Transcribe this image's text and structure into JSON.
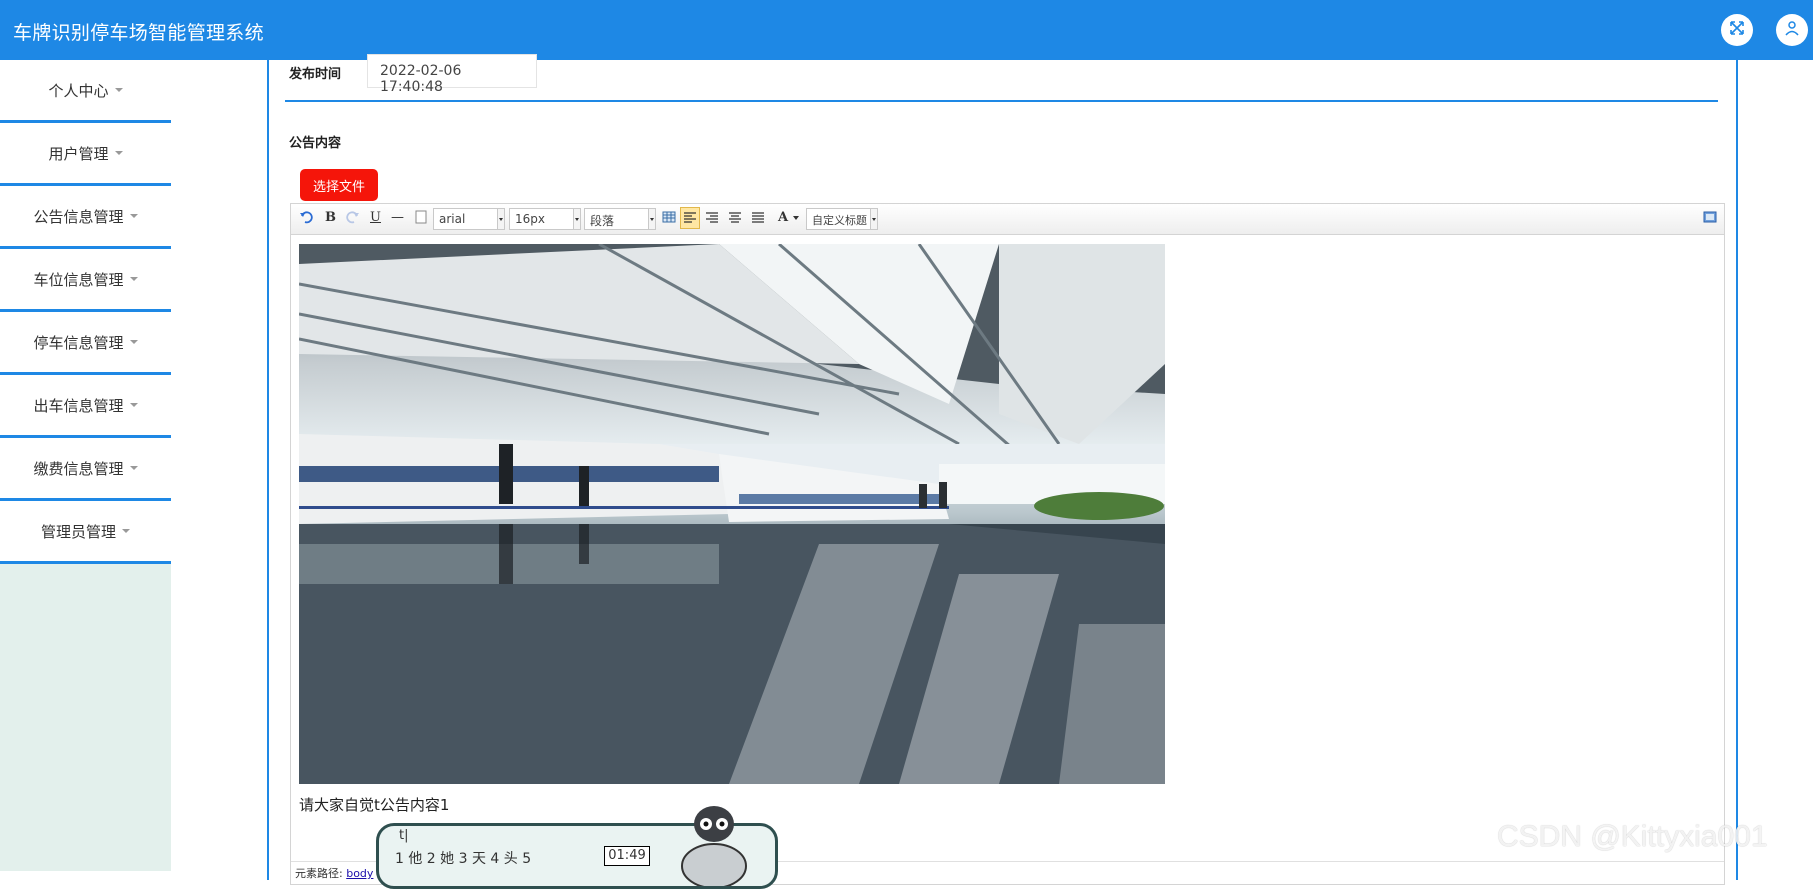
{
  "header": {
    "title": "车牌识别停车场智能管理系统",
    "fullscreen_icon": "expand-icon",
    "user_icon": "user-icon",
    "colors": {
      "bar": "#1e88e5",
      "accent": "#1e88e5"
    }
  },
  "sidebar": {
    "items": [
      {
        "label": "个人中心"
      },
      {
        "label": "用户管理"
      },
      {
        "label": "公告信息管理"
      },
      {
        "label": "车位信息管理"
      },
      {
        "label": "停车信息管理"
      },
      {
        "label": "出车信息管理"
      },
      {
        "label": "缴费信息管理"
      },
      {
        "label": "管理员管理"
      }
    ]
  },
  "form": {
    "publish_time_label": "发布时间",
    "publish_time_value": "2022-02-06 17:40:48",
    "content_label": "公告内容",
    "file_button_label": "选择文件",
    "file_button_color": "#f5150a"
  },
  "editor": {
    "toolbar": {
      "undo_icon": "undo-icon",
      "bold_label": "B",
      "redo_icon": "redo-icon",
      "underline_label": "U",
      "hr_label": "—",
      "page_icon": "page-icon",
      "font_family": "arial",
      "font_size": "16px",
      "paragraph": "段落",
      "table_icon": "table-icon",
      "align_left_icon": "align-left-icon",
      "align_right_icon": "align-right-icon",
      "align_center_icon": "align-center-icon",
      "justify_icon": "justify-icon",
      "font_color_label": "A",
      "custom_title": "自定义标题",
      "fullscreen_icon": "editor-fullscreen-icon"
    },
    "image_icon": "train-station-photo",
    "content_text": "请大家自觉t公告内容1",
    "element_path_label": "元素路径:",
    "element_path_link": "body"
  },
  "ime": {
    "input": "t|",
    "candidates": "1 他  2 她  3 天  4 头  5"
  },
  "clock": "01:49",
  "watermark": "CSDN @Kittyxia001"
}
